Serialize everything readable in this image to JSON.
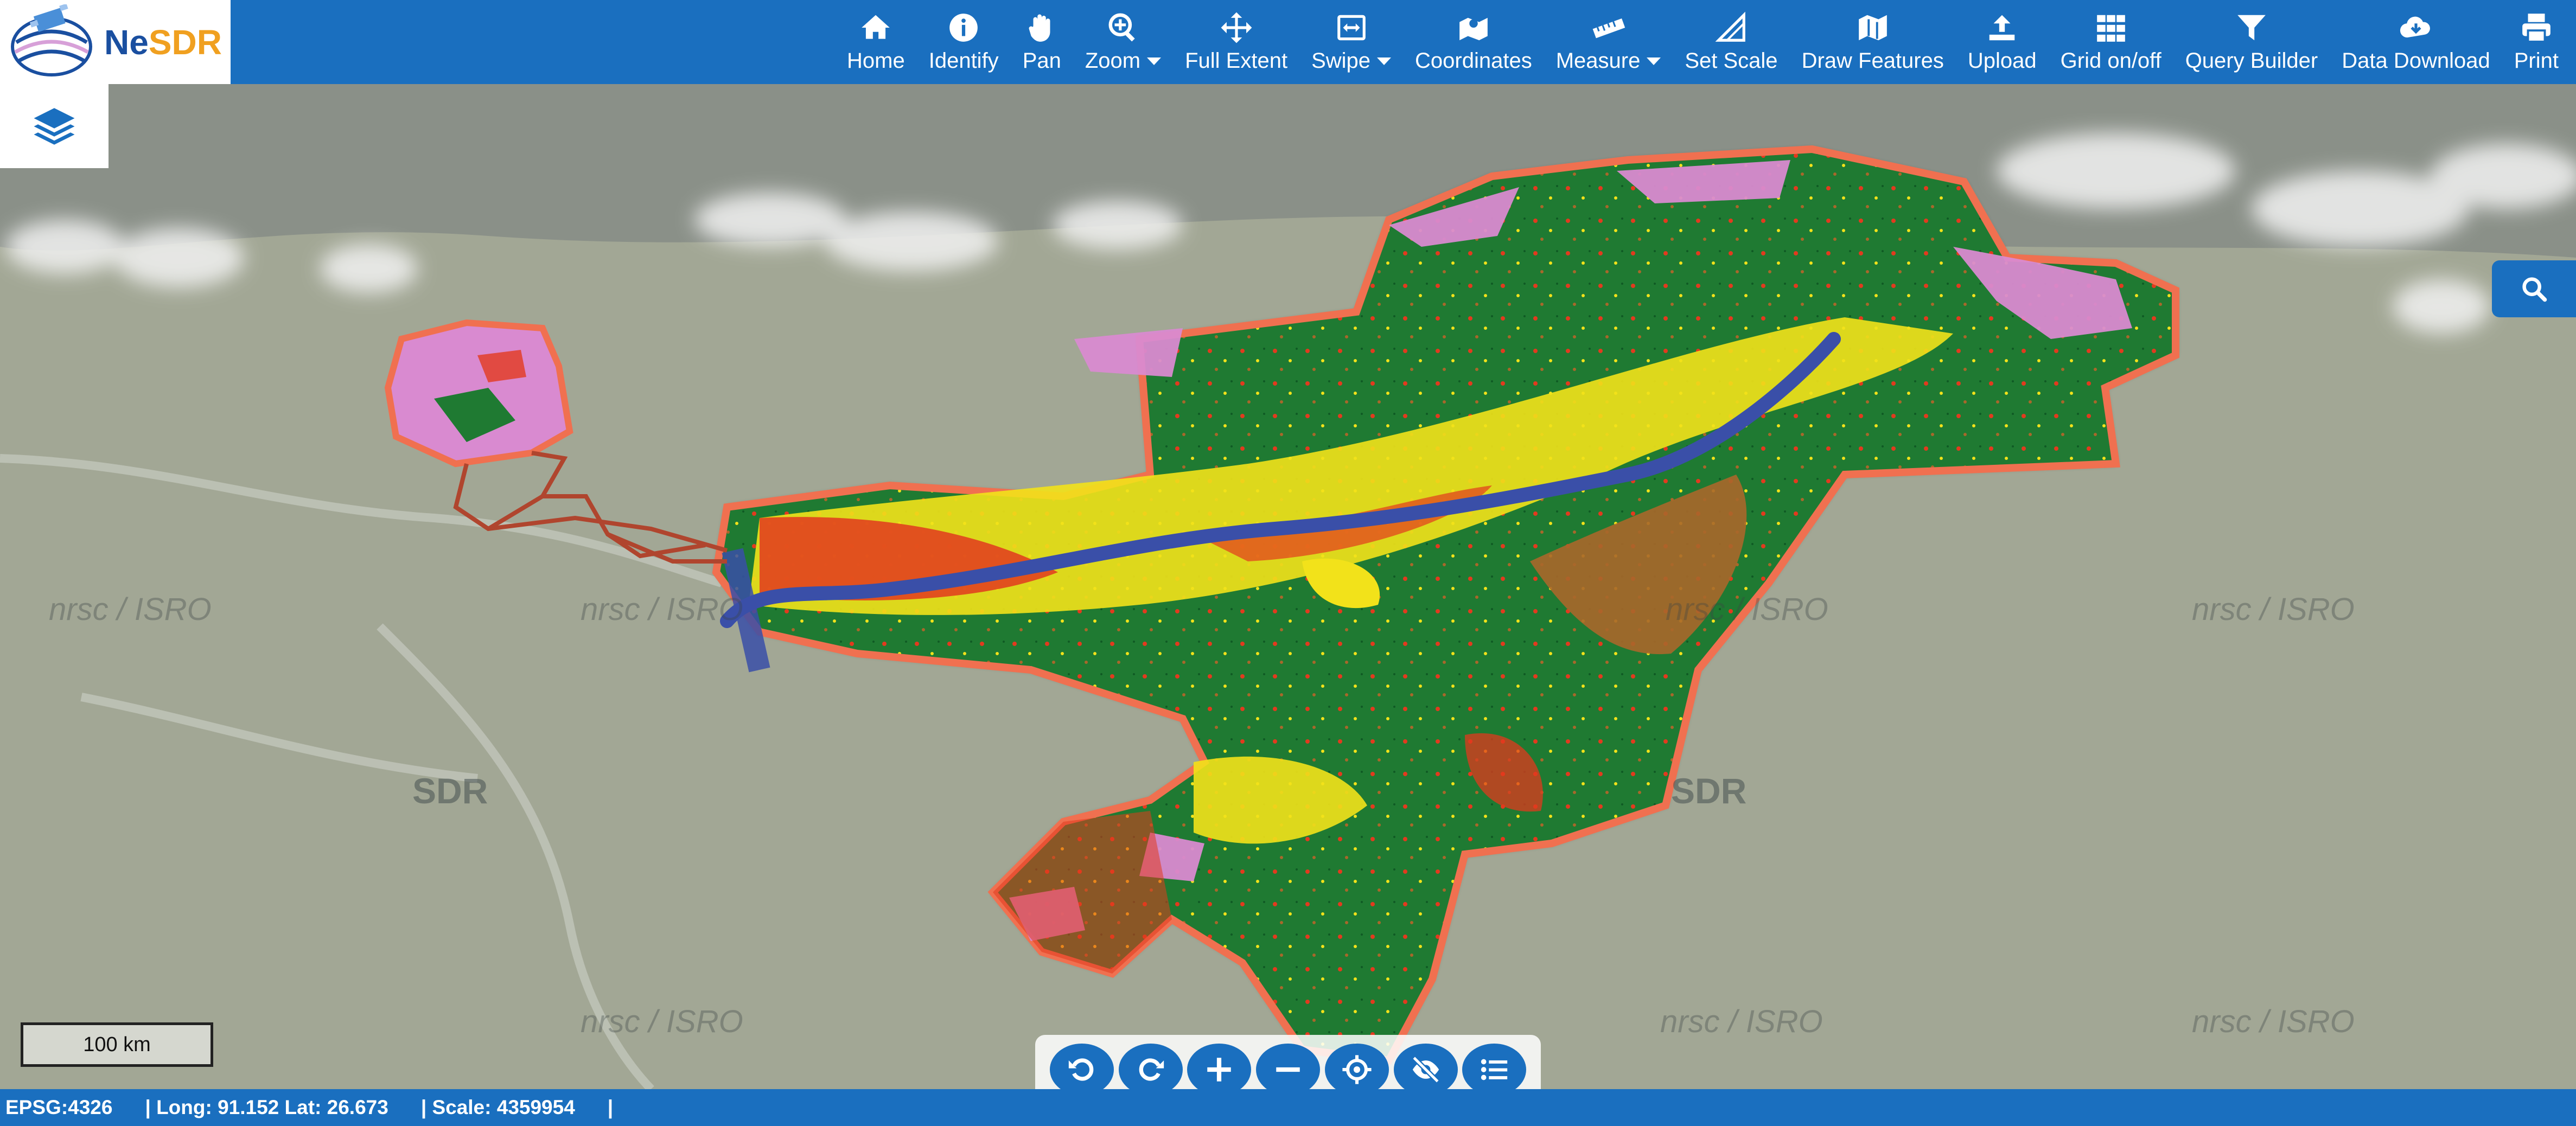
{
  "logo": {
    "text_main": "Ne",
    "text_accent": "SDR"
  },
  "toolbar": {
    "items": [
      {
        "label": "Home",
        "icon": "home-icon",
        "has_dropdown": false
      },
      {
        "label": "Identify",
        "icon": "info-icon",
        "has_dropdown": false
      },
      {
        "label": "Pan",
        "icon": "hand-icon",
        "has_dropdown": false
      },
      {
        "label": "Zoom",
        "icon": "zoom-icon",
        "has_dropdown": true
      },
      {
        "label": "Full Extent",
        "icon": "move-arrows-icon",
        "has_dropdown": false
      },
      {
        "label": "Swipe",
        "icon": "swipe-icon",
        "has_dropdown": true
      },
      {
        "label": "Coordinates",
        "icon": "map-pin-icon",
        "has_dropdown": false
      },
      {
        "label": "Measure",
        "icon": "ruler-icon",
        "has_dropdown": true
      },
      {
        "label": "Set Scale",
        "icon": "set-square-icon",
        "has_dropdown": false
      },
      {
        "label": "Draw Features",
        "icon": "map-draw-icon",
        "has_dropdown": false
      },
      {
        "label": "Upload",
        "icon": "upload-icon",
        "has_dropdown": false
      },
      {
        "label": "Grid on/off",
        "icon": "grid-icon",
        "has_dropdown": false
      },
      {
        "label": "Query Builder",
        "icon": "filter-icon",
        "has_dropdown": false
      },
      {
        "label": "Data Download",
        "icon": "cloud-download-icon",
        "has_dropdown": false
      },
      {
        "label": "Print",
        "icon": "print-icon",
        "has_dropdown": false
      }
    ]
  },
  "map": {
    "watermarks": [
      "nrsc / ISRO",
      "SDR"
    ],
    "scale_label": "100 km"
  },
  "map_controls": [
    {
      "name": "undo-button",
      "icon": "undo-icon"
    },
    {
      "name": "redo-button",
      "icon": "redo-icon"
    },
    {
      "name": "zoom-in-button",
      "icon": "plus-icon"
    },
    {
      "name": "zoom-out-button",
      "icon": "minus-icon"
    },
    {
      "name": "locate-button",
      "icon": "crosshair-icon"
    },
    {
      "name": "hide-layers-button",
      "icon": "eye-off-icon"
    },
    {
      "name": "legend-button",
      "icon": "list-icon"
    }
  ],
  "status": {
    "epsg": "EPSG:4326",
    "coords": "| Long: 91.152 Lat: 26.673",
    "scale": "| Scale: 4359954",
    "tail": "|"
  },
  "colors": {
    "toolbar": "#1a6fbf",
    "forest": "#1f7a32",
    "cropland": "#f2e21a",
    "fallow": "#e23a1e",
    "water": "#3a4fa8",
    "snow_grass": "#d98ad0",
    "scrub": "#a8672a",
    "boundary": "#f07050"
  }
}
